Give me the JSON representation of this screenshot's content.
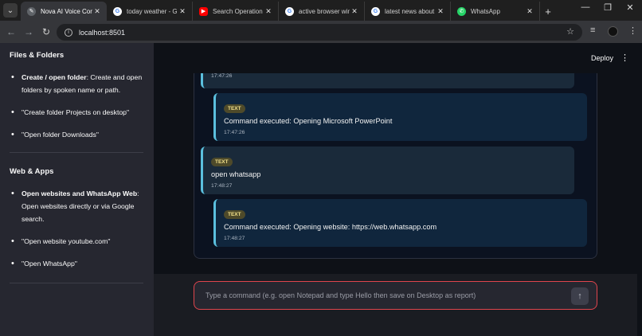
{
  "browser": {
    "tabs": [
      {
        "title": "Nova AI Voice Com",
        "icon": "app-icon",
        "color": "#5f6368",
        "active": true
      },
      {
        "title": "today weather - G",
        "icon": "google-icon",
        "color": "#4285f4",
        "active": false
      },
      {
        "title": "Search Operation",
        "icon": "youtube-icon",
        "color": "#ff0000",
        "active": false
      },
      {
        "title": "active browser win",
        "icon": "google-icon",
        "color": "#4285f4",
        "active": false
      },
      {
        "title": "latest news about",
        "icon": "google-icon",
        "color": "#4285f4",
        "active": false
      },
      {
        "title": "WhatsApp",
        "icon": "whatsapp-icon",
        "color": "#25d366",
        "active": false
      }
    ],
    "new_tab": "+",
    "url": "localhost:8501"
  },
  "header": {
    "deploy_label": "Deploy"
  },
  "sidebar": {
    "sections": [
      {
        "heading": "Files & Folders",
        "items": [
          {
            "bold": "Create / open folder",
            "text": ": Create and open folders by spoken name or path."
          },
          {
            "bold": "",
            "text": "\"Create folder Projects on desktop\""
          },
          {
            "bold": "",
            "text": "\"Open folder Downloads\""
          }
        ]
      },
      {
        "heading": "Web & Apps",
        "items": [
          {
            "bold": "Open websites and WhatsApp Web",
            "text": ": Open websites directly or via Google search."
          },
          {
            "bold": "",
            "text": "\"Open website youtube.com\""
          },
          {
            "bold": "",
            "text": "\"Open WhatsApp\""
          }
        ]
      }
    ]
  },
  "chat": {
    "messages": [
      {
        "role": "user",
        "badge": "",
        "text": "",
        "time": "17:47:26"
      },
      {
        "role": "bot",
        "badge": "TEXT",
        "text": "Command executed: Opening Microsoft PowerPoint",
        "time": "17:47:26"
      },
      {
        "role": "user",
        "badge": "TEXT",
        "text": "open whatsapp",
        "time": "17:48:27"
      },
      {
        "role": "bot",
        "badge": "TEXT",
        "text": "Command executed: Opening website: https://web.whatsapp.com",
        "time": "17:48:27"
      }
    ]
  },
  "input": {
    "placeholder": "Type a command (e.g. open Notepad and type Hello then save on Desktop as report)"
  }
}
